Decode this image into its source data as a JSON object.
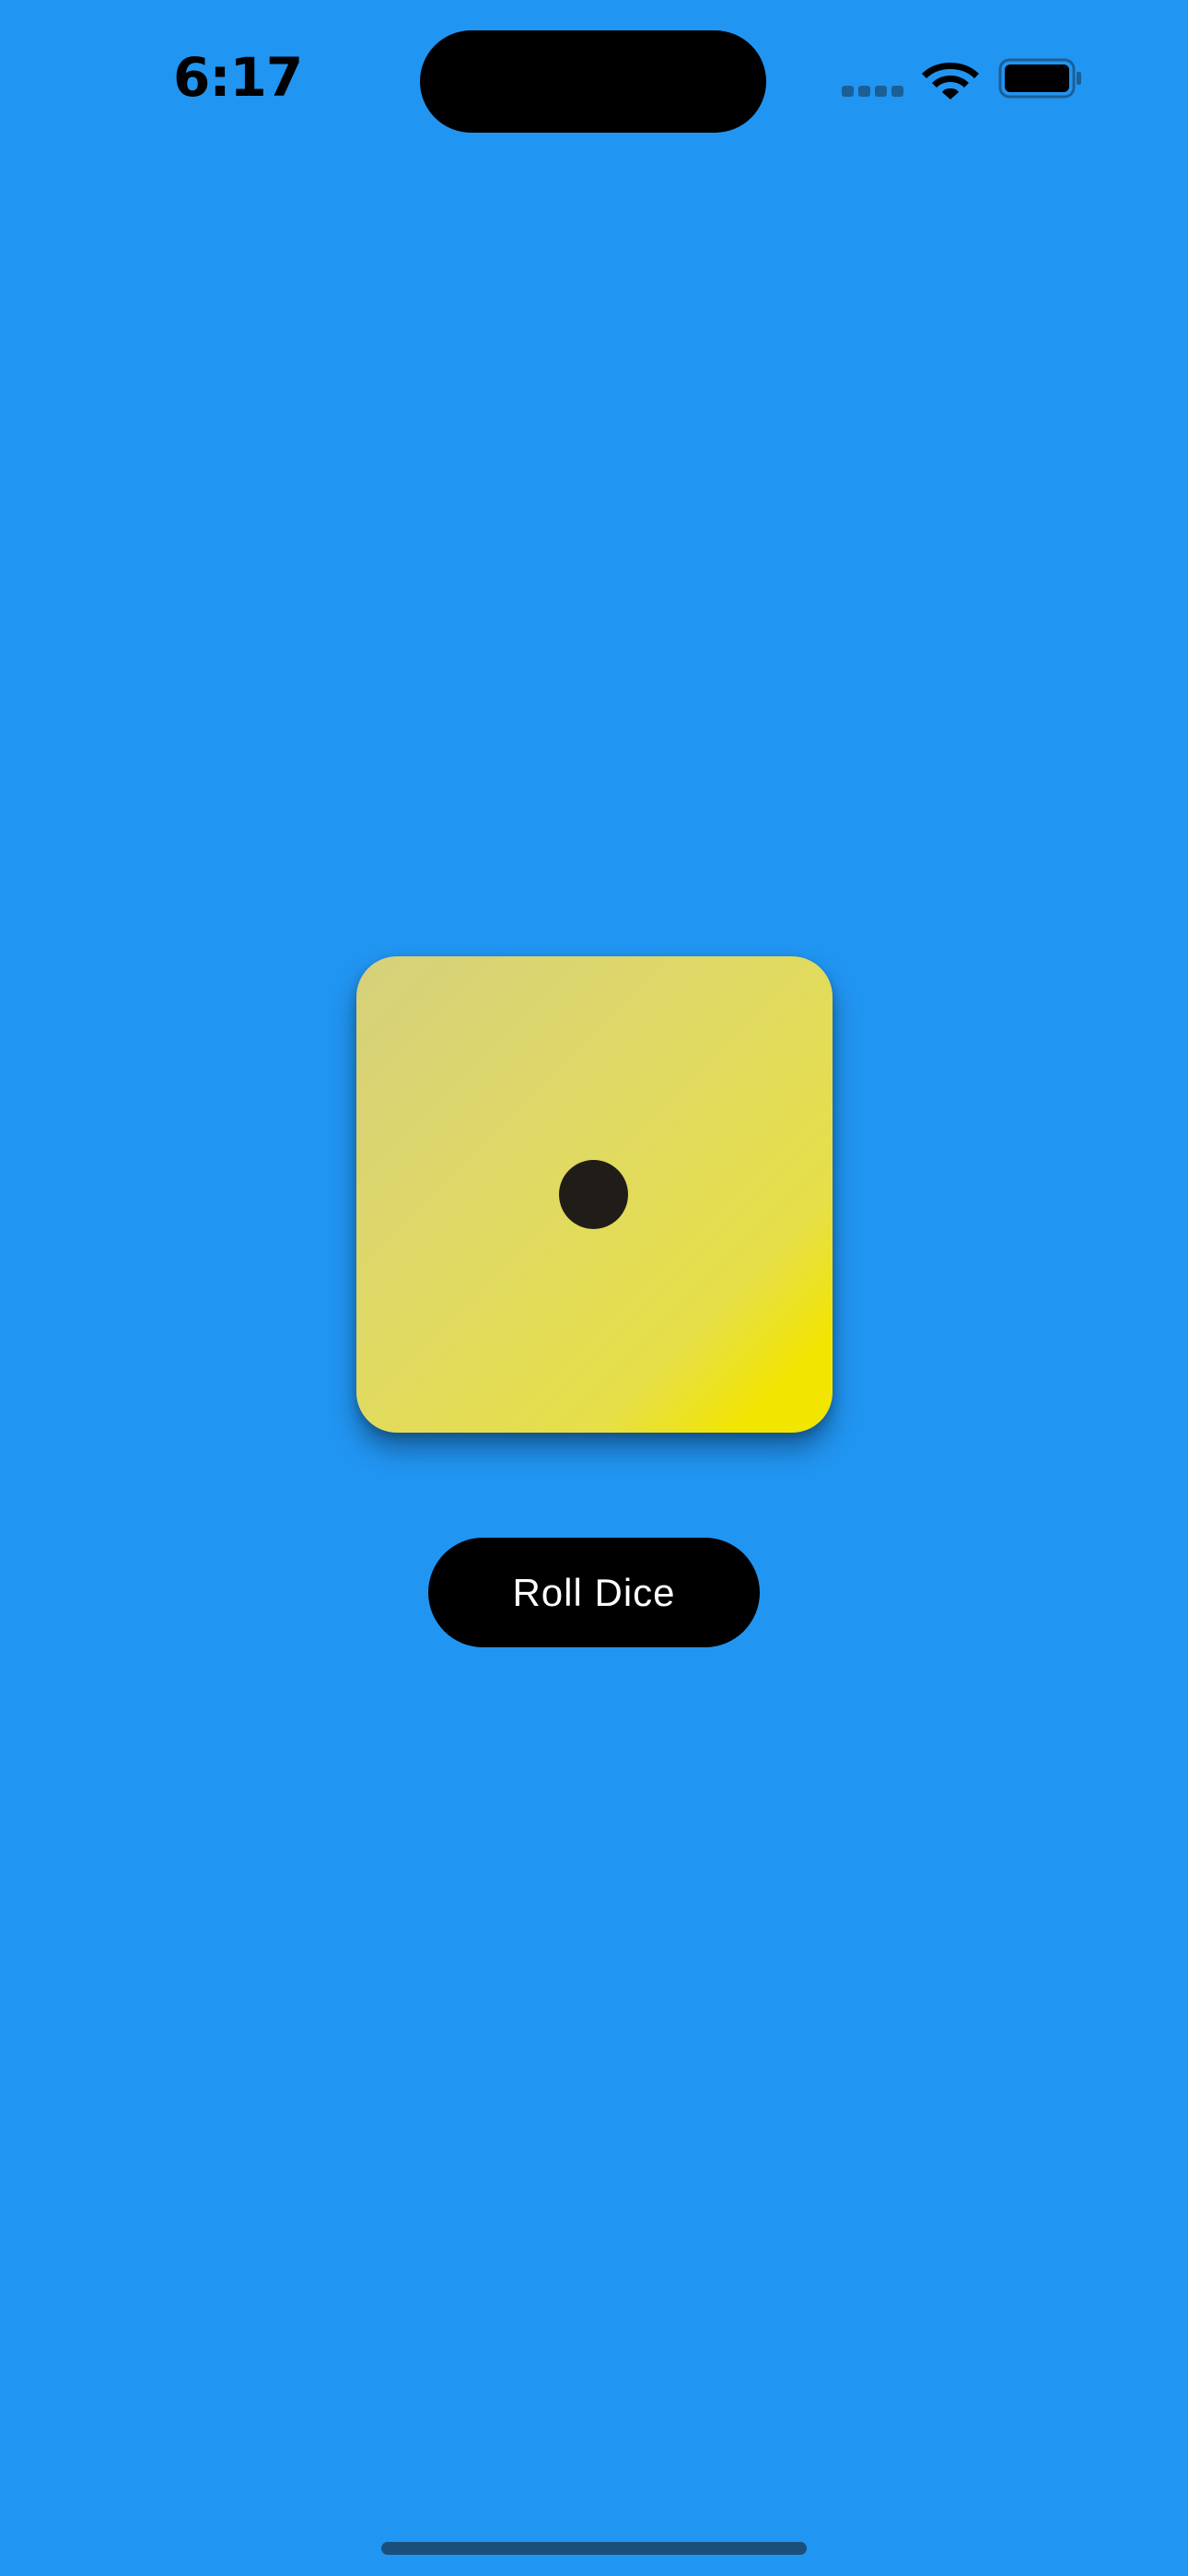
{
  "status_bar": {
    "time": "6:17",
    "icons": [
      "cellular-signal-icon",
      "wifi-icon",
      "battery-icon"
    ]
  },
  "dice": {
    "face_value": 1,
    "colors": {
      "face_gradient_start": "#d6d07c",
      "face_gradient_end": "#f2e500",
      "pip": "#201d18"
    }
  },
  "roll_button": {
    "label": "Roll Dice"
  },
  "colors": {
    "background": "#2195f2",
    "button": "#000000",
    "button_text": "#ffffff"
  }
}
